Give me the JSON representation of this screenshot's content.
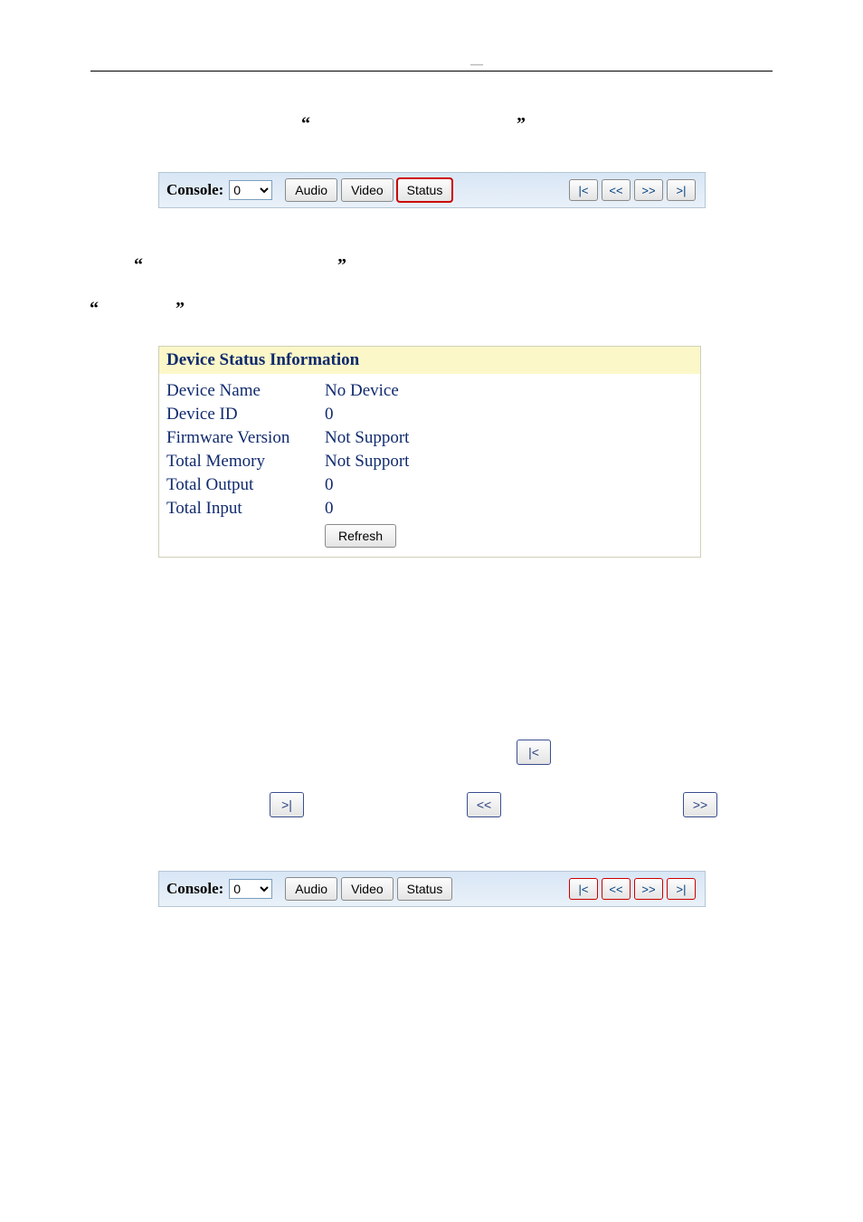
{
  "header": {
    "dash": "—"
  },
  "quotes": {
    "open": "“",
    "close": "”"
  },
  "console_bar": {
    "label": "Console:",
    "selected": "0",
    "tabs": {
      "audio": "Audio",
      "video": "Video",
      "status": "Status"
    },
    "nav": {
      "first": "|<",
      "prev": "<<",
      "next": ">>",
      "last": ">|"
    }
  },
  "status": {
    "title": "Device Status Information",
    "rows": [
      {
        "k": "Device Name",
        "v": "No Device"
      },
      {
        "k": "Device ID",
        "v": "0"
      },
      {
        "k": "Firmware Version",
        "v": "Not Support"
      },
      {
        "k": "Total Memory",
        "v": "Not Support"
      },
      {
        "k": "Total Output",
        "v": "0"
      },
      {
        "k": "Total Input",
        "v": "0"
      }
    ],
    "refresh": "Refresh"
  },
  "mini": {
    "first": "|<",
    "last": ">|",
    "prev": "<<",
    "next": ">>"
  }
}
